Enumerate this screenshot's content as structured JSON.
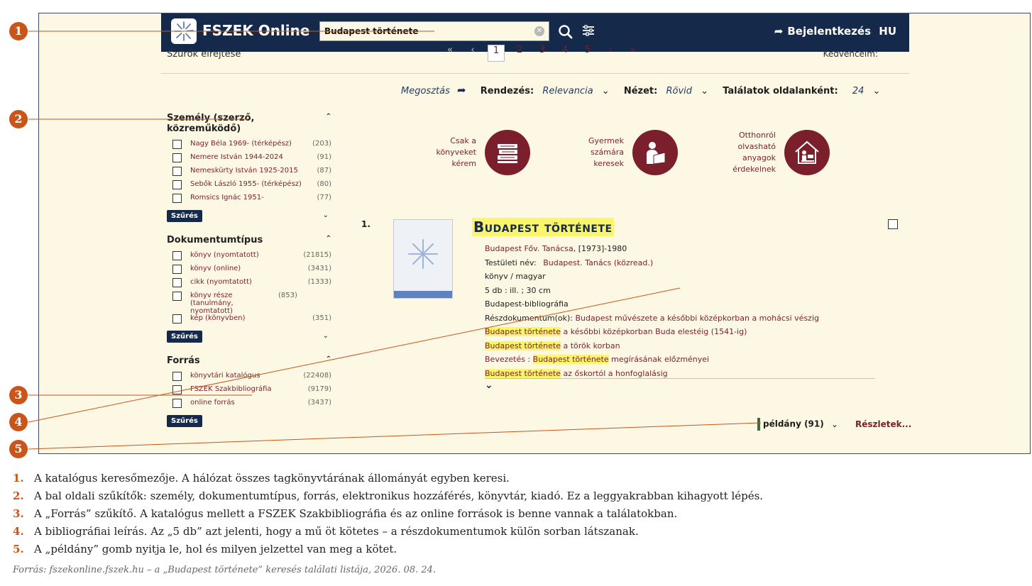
{
  "header": {
    "app_title": "FSZEK Online",
    "search_value": "Budapest története",
    "login_label": "Bejelentkezés",
    "lang": "HU"
  },
  "pager": {
    "filters_clear": "Szűrők elrejtése",
    "pages": [
      "1",
      "2",
      "3",
      "4",
      "5"
    ],
    "current": "1",
    "favorites": "Kedvenceim:"
  },
  "toolbar": {
    "share": "Megosztás",
    "sort_label": "Rendezés:",
    "sort_value": "Relevancia",
    "view_label": "Nézet:",
    "view_value": "Rövid",
    "per_page_label": "Találatok oldalanként:",
    "per_page_value": "24"
  },
  "facets": [
    {
      "title": "Személy (szerző, közreműködő)",
      "items": [
        {
          "label": "Nagy Béla 1969- (térképész)",
          "count": "(203)"
        },
        {
          "label": "Nemere István 1944-2024",
          "count": "(91)"
        },
        {
          "label": "Nemeskürty István 1925-2015",
          "count": "(87)"
        },
        {
          "label": "Sebők László 1955- (térképész)",
          "count": "(80)"
        },
        {
          "label": "Romsics Ignác 1951-",
          "count": "(77)"
        }
      ],
      "button": "Szűrés"
    },
    {
      "title": "Dokumentumtípus",
      "items": [
        {
          "label": "könyv (nyomtatott)",
          "count": "(21815)"
        },
        {
          "label": "könyv (online)",
          "count": "(3431)"
        },
        {
          "label": "cikk (nyomtatott)",
          "count": "(1333)"
        },
        {
          "label": "könyv része (tanulmány, nyomtatott)",
          "count": "(853)"
        },
        {
          "label": "kép (könyvben)",
          "count": "(351)"
        }
      ],
      "button": "Szűrés"
    },
    {
      "title": "Forrás",
      "items": [
        {
          "label": "könyvtári katalógus",
          "count": "(22408)"
        },
        {
          "label": "FSZEK Szakbibliográfia",
          "count": "(9179)"
        },
        {
          "label": "online forrás",
          "count": "(3437)"
        }
      ],
      "button": "Szűrés"
    }
  ],
  "tiles": [
    {
      "label": "Csak a könyveket kérem"
    },
    {
      "label": "Gyermek számára keresek"
    },
    {
      "label": "Otthonról olvasható anyagok érdekelnek"
    }
  ],
  "result": {
    "number": "1.",
    "title": "Budapest története",
    "publisher": "Budapest Főv. Tanácsa",
    "date": ", [1973]-1980",
    "corp_label": "Testületi név:",
    "corp_value": "Budapest. Tanács (közread.)",
    "type": "könyv / magyar",
    "extent": "5 db : ill. ; 30 cm",
    "series": "Budapest-bibliográfia",
    "parts_label": "Részdokumentum(ok):",
    "parts": [
      {
        "hl": "",
        "rest": "Budapest művészete a későbbi középkorban a mohácsi vészig"
      },
      {
        "hl": "Budapest története",
        "rest": " a későbbi középkorban Buda elestéig (1541-ig)"
      },
      {
        "hl": "Budapest története",
        "rest": " a török korban"
      },
      {
        "prefix": "Bevezetés : ",
        "hl": "Budapest története",
        "rest": " megírásának előzményei"
      },
      {
        "hl": "Budapest története",
        "rest": " az őskortól a honfoglalásig"
      }
    ],
    "copies": "példány (91)",
    "details": "Részletek..."
  },
  "annotations": {
    "numbers": [
      "1",
      "2",
      "3",
      "4",
      "5"
    ],
    "captions": [
      "A katalógus keresőmezője. A hálózat összes tagkönyvtárának állományát egyben keresi.",
      "A bal oldali szűkítők: személy, dokumentumtípus, forrás, elektronikus hozzáférés, könyvtár, kiadó. Ez a leggyakrabban kihagyott lépés.",
      "A „Forrás” szűkítő. A katalógus mellett a FSZEK Szakbibliográfia és az online források is benne vannak a találatokban.",
      "A bibliográfiai leírás. Az „5 db” azt jelenti, hogy a mű öt kötetes – a részdokumentumok külön sorban látszanak.",
      "A „példány” gomb nyitja le, hol és milyen jelzettel van meg a kötet."
    ],
    "source": "Forrás: fszekonline.fszek.hu – a „Budapest története” keresés találati listája, 2026. 08. 24."
  },
  "colors": {
    "navy": "#152a4a",
    "maroon": "#7a1f2b",
    "highlight": "#fbf56a",
    "accent": "#c8551a",
    "background": "#fdf8e4"
  },
  "icons": [
    "logo-icon",
    "clear-icon",
    "search-icon",
    "filter-settings-icon",
    "login-icon",
    "share-icon",
    "chevron-down-icon",
    "books-icon",
    "reading-child-icon",
    "home-reading-icon"
  ]
}
